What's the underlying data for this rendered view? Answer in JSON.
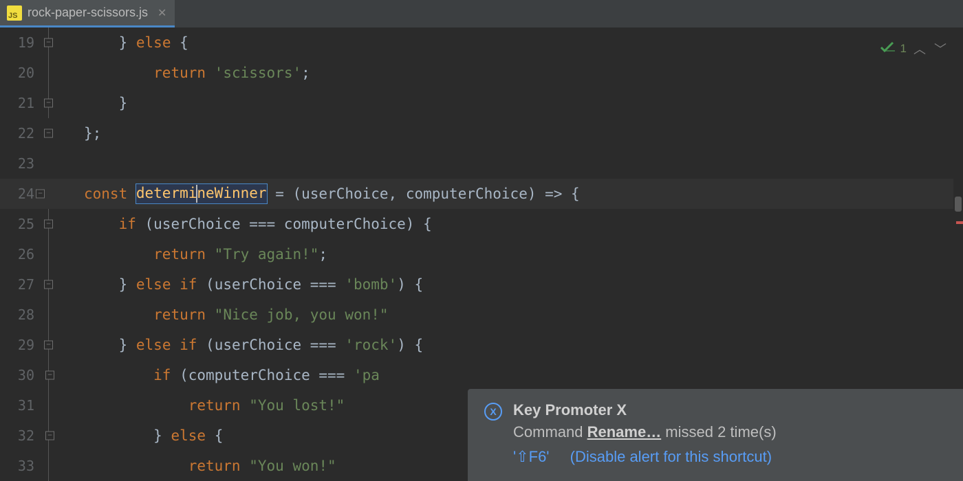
{
  "tab": {
    "filename": "rock-paper-scissors.js",
    "icon_label": "JS"
  },
  "inspection": {
    "count": "1"
  },
  "line_numbers": [
    "19",
    "20",
    "21",
    "22",
    "23",
    "24",
    "25",
    "26",
    "27",
    "28",
    "29",
    "30",
    "31",
    "32",
    "33"
  ],
  "code": {
    "l19": {
      "brace": "}",
      "kw": "else",
      "brace2": "{"
    },
    "l20": {
      "kw": "return",
      "str": "'scissors'",
      "semi": ";"
    },
    "l21": {
      "brace": "}"
    },
    "l22": {
      "brace": "};"
    },
    "l24": {
      "kw": "const",
      "name_a": "determi",
      "name_b": "neWinner",
      "rest": " = (userChoice, computerChoice) => {"
    },
    "l25": {
      "kw": "if",
      "cond": " (userChoice === computerChoice) {"
    },
    "l26": {
      "kw": "return",
      "str": "\"Try again!\"",
      "semi": ";"
    },
    "l27": {
      "brace": "}",
      "kw": "else if",
      "cond": " (userChoice === ",
      "str": "'bomb'",
      "rest": ") {"
    },
    "l28": {
      "kw": "return",
      "str": "\"Nice job, you won!\""
    },
    "l29": {
      "brace": "}",
      "kw": "else if",
      "cond": " (userChoice === ",
      "str": "'rock'",
      "rest": ") {"
    },
    "l30": {
      "kw": "if",
      "cond": " (computerChoice === ",
      "str": "'pa"
    },
    "l31": {
      "kw": "return",
      "str": "\"You lost!\""
    },
    "l32": {
      "brace": "}",
      "kw": "else",
      "brace2": "{"
    },
    "l33": {
      "kw": "return",
      "str": "\"You won!\""
    }
  },
  "notification": {
    "title": "Key Promoter X",
    "text_prefix": "Command ",
    "command": "Rename…",
    "text_suffix": " missed 2 time(s)",
    "shortcut": "'⇧F6'",
    "disable": "(Disable alert for this shortcut)"
  }
}
